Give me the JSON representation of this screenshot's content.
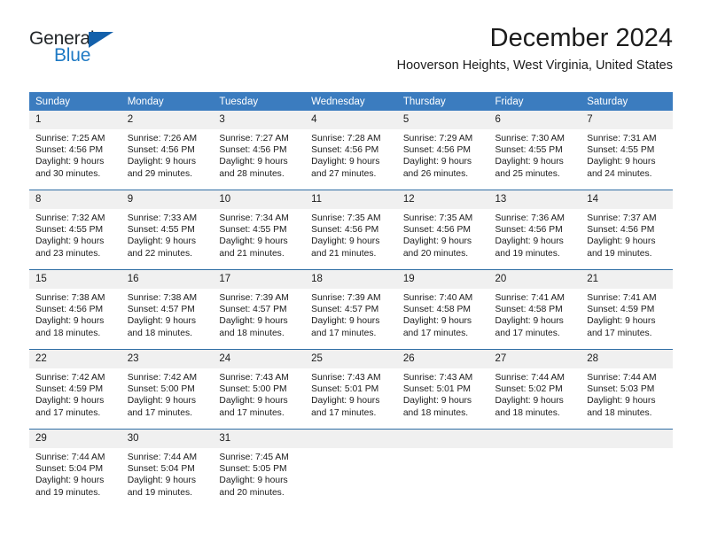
{
  "brand": {
    "name_top": "General",
    "name_bottom": "Blue",
    "triangle_color": "#1461ab",
    "blue_color": "#1f7ac4"
  },
  "header": {
    "title": "December 2024",
    "subtitle": "Hooverson Heights, West Virginia, United States"
  },
  "theme": {
    "header_blue": "#3b7cbf",
    "row_divider": "#2e6da4",
    "daynum_band": "#f0f0f0"
  },
  "weekday_headers": [
    "Sunday",
    "Monday",
    "Tuesday",
    "Wednesday",
    "Thursday",
    "Friday",
    "Saturday"
  ],
  "weeks": [
    [
      {
        "day": "1",
        "sunrise": "Sunrise: 7:25 AM",
        "sunset": "Sunset: 4:56 PM",
        "daylight1": "Daylight: 9 hours",
        "daylight2": "and 30 minutes."
      },
      {
        "day": "2",
        "sunrise": "Sunrise: 7:26 AM",
        "sunset": "Sunset: 4:56 PM",
        "daylight1": "Daylight: 9 hours",
        "daylight2": "and 29 minutes."
      },
      {
        "day": "3",
        "sunrise": "Sunrise: 7:27 AM",
        "sunset": "Sunset: 4:56 PM",
        "daylight1": "Daylight: 9 hours",
        "daylight2": "and 28 minutes."
      },
      {
        "day": "4",
        "sunrise": "Sunrise: 7:28 AM",
        "sunset": "Sunset: 4:56 PM",
        "daylight1": "Daylight: 9 hours",
        "daylight2": "and 27 minutes."
      },
      {
        "day": "5",
        "sunrise": "Sunrise: 7:29 AM",
        "sunset": "Sunset: 4:56 PM",
        "daylight1": "Daylight: 9 hours",
        "daylight2": "and 26 minutes."
      },
      {
        "day": "6",
        "sunrise": "Sunrise: 7:30 AM",
        "sunset": "Sunset: 4:55 PM",
        "daylight1": "Daylight: 9 hours",
        "daylight2": "and 25 minutes."
      },
      {
        "day": "7",
        "sunrise": "Sunrise: 7:31 AM",
        "sunset": "Sunset: 4:55 PM",
        "daylight1": "Daylight: 9 hours",
        "daylight2": "and 24 minutes."
      }
    ],
    [
      {
        "day": "8",
        "sunrise": "Sunrise: 7:32 AM",
        "sunset": "Sunset: 4:55 PM",
        "daylight1": "Daylight: 9 hours",
        "daylight2": "and 23 minutes."
      },
      {
        "day": "9",
        "sunrise": "Sunrise: 7:33 AM",
        "sunset": "Sunset: 4:55 PM",
        "daylight1": "Daylight: 9 hours",
        "daylight2": "and 22 minutes."
      },
      {
        "day": "10",
        "sunrise": "Sunrise: 7:34 AM",
        "sunset": "Sunset: 4:55 PM",
        "daylight1": "Daylight: 9 hours",
        "daylight2": "and 21 minutes."
      },
      {
        "day": "11",
        "sunrise": "Sunrise: 7:35 AM",
        "sunset": "Sunset: 4:56 PM",
        "daylight1": "Daylight: 9 hours",
        "daylight2": "and 21 minutes."
      },
      {
        "day": "12",
        "sunrise": "Sunrise: 7:35 AM",
        "sunset": "Sunset: 4:56 PM",
        "daylight1": "Daylight: 9 hours",
        "daylight2": "and 20 minutes."
      },
      {
        "day": "13",
        "sunrise": "Sunrise: 7:36 AM",
        "sunset": "Sunset: 4:56 PM",
        "daylight1": "Daylight: 9 hours",
        "daylight2": "and 19 minutes."
      },
      {
        "day": "14",
        "sunrise": "Sunrise: 7:37 AM",
        "sunset": "Sunset: 4:56 PM",
        "daylight1": "Daylight: 9 hours",
        "daylight2": "and 19 minutes."
      }
    ],
    [
      {
        "day": "15",
        "sunrise": "Sunrise: 7:38 AM",
        "sunset": "Sunset: 4:56 PM",
        "daylight1": "Daylight: 9 hours",
        "daylight2": "and 18 minutes."
      },
      {
        "day": "16",
        "sunrise": "Sunrise: 7:38 AM",
        "sunset": "Sunset: 4:57 PM",
        "daylight1": "Daylight: 9 hours",
        "daylight2": "and 18 minutes."
      },
      {
        "day": "17",
        "sunrise": "Sunrise: 7:39 AM",
        "sunset": "Sunset: 4:57 PM",
        "daylight1": "Daylight: 9 hours",
        "daylight2": "and 18 minutes."
      },
      {
        "day": "18",
        "sunrise": "Sunrise: 7:39 AM",
        "sunset": "Sunset: 4:57 PM",
        "daylight1": "Daylight: 9 hours",
        "daylight2": "and 17 minutes."
      },
      {
        "day": "19",
        "sunrise": "Sunrise: 7:40 AM",
        "sunset": "Sunset: 4:58 PM",
        "daylight1": "Daylight: 9 hours",
        "daylight2": "and 17 minutes."
      },
      {
        "day": "20",
        "sunrise": "Sunrise: 7:41 AM",
        "sunset": "Sunset: 4:58 PM",
        "daylight1": "Daylight: 9 hours",
        "daylight2": "and 17 minutes."
      },
      {
        "day": "21",
        "sunrise": "Sunrise: 7:41 AM",
        "sunset": "Sunset: 4:59 PM",
        "daylight1": "Daylight: 9 hours",
        "daylight2": "and 17 minutes."
      }
    ],
    [
      {
        "day": "22",
        "sunrise": "Sunrise: 7:42 AM",
        "sunset": "Sunset: 4:59 PM",
        "daylight1": "Daylight: 9 hours",
        "daylight2": "and 17 minutes."
      },
      {
        "day": "23",
        "sunrise": "Sunrise: 7:42 AM",
        "sunset": "Sunset: 5:00 PM",
        "daylight1": "Daylight: 9 hours",
        "daylight2": "and 17 minutes."
      },
      {
        "day": "24",
        "sunrise": "Sunrise: 7:43 AM",
        "sunset": "Sunset: 5:00 PM",
        "daylight1": "Daylight: 9 hours",
        "daylight2": "and 17 minutes."
      },
      {
        "day": "25",
        "sunrise": "Sunrise: 7:43 AM",
        "sunset": "Sunset: 5:01 PM",
        "daylight1": "Daylight: 9 hours",
        "daylight2": "and 17 minutes."
      },
      {
        "day": "26",
        "sunrise": "Sunrise: 7:43 AM",
        "sunset": "Sunset: 5:01 PM",
        "daylight1": "Daylight: 9 hours",
        "daylight2": "and 18 minutes."
      },
      {
        "day": "27",
        "sunrise": "Sunrise: 7:44 AM",
        "sunset": "Sunset: 5:02 PM",
        "daylight1": "Daylight: 9 hours",
        "daylight2": "and 18 minutes."
      },
      {
        "day": "28",
        "sunrise": "Sunrise: 7:44 AM",
        "sunset": "Sunset: 5:03 PM",
        "daylight1": "Daylight: 9 hours",
        "daylight2": "and 18 minutes."
      }
    ],
    [
      {
        "day": "29",
        "sunrise": "Sunrise: 7:44 AM",
        "sunset": "Sunset: 5:04 PM",
        "daylight1": "Daylight: 9 hours",
        "daylight2": "and 19 minutes."
      },
      {
        "day": "30",
        "sunrise": "Sunrise: 7:44 AM",
        "sunset": "Sunset: 5:04 PM",
        "daylight1": "Daylight: 9 hours",
        "daylight2": "and 19 minutes."
      },
      {
        "day": "31",
        "sunrise": "Sunrise: 7:45 AM",
        "sunset": "Sunset: 5:05 PM",
        "daylight1": "Daylight: 9 hours",
        "daylight2": "and 20 minutes."
      },
      {
        "day": "",
        "sunrise": "",
        "sunset": "",
        "daylight1": "",
        "daylight2": ""
      },
      {
        "day": "",
        "sunrise": "",
        "sunset": "",
        "daylight1": "",
        "daylight2": ""
      },
      {
        "day": "",
        "sunrise": "",
        "sunset": "",
        "daylight1": "",
        "daylight2": ""
      },
      {
        "day": "",
        "sunrise": "",
        "sunset": "",
        "daylight1": "",
        "daylight2": ""
      }
    ]
  ]
}
